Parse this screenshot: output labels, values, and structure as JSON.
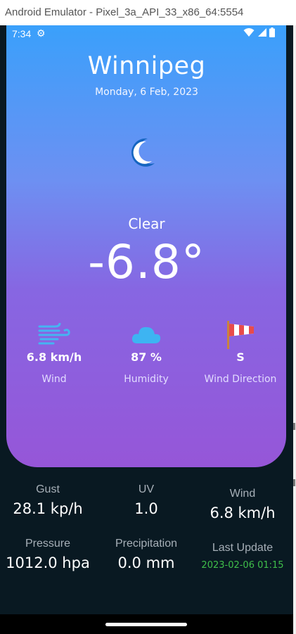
{
  "emulator": {
    "title": "Android Emulator - Pixel_3a_API_33_x86_64:5554"
  },
  "status_bar": {
    "time": "7:34",
    "icons": [
      "gear-icon",
      "wifi-icon",
      "signal-icon",
      "battery-icon"
    ]
  },
  "weather": {
    "city": "Winnipeg",
    "date": "Monday, 6 Feb, 2023",
    "icon": "moon-icon",
    "condition": "Clear",
    "temperature": "-6.8°"
  },
  "metrics": [
    {
      "icon": "wind-icon",
      "value": "6.8 km/h",
      "label": "Wind"
    },
    {
      "icon": "cloud-icon",
      "value": "87 %",
      "label": "Humidity"
    },
    {
      "icon": "windsock-icon",
      "value": "S",
      "label": "Wind Direction"
    }
  ],
  "details": {
    "gust": {
      "label": "Gust",
      "value": "28.1 kp/h"
    },
    "uv": {
      "label": "UV",
      "value": "1.0"
    },
    "wind": {
      "label": "Wind",
      "value": "6.8 km/h"
    },
    "pressure": {
      "label": "Pressure",
      "value": "1012.0 hpa"
    },
    "precipitation": {
      "label": "Precipitation",
      "value": "0.0 mm"
    },
    "last_update": {
      "label": "Last Update",
      "value": "2023-02-06 01:15"
    }
  },
  "colors": {
    "gradient_top": "#3aa0fb",
    "gradient_bottom": "#9656d8",
    "background": "#091922",
    "last_update": "#3fbf4a"
  }
}
